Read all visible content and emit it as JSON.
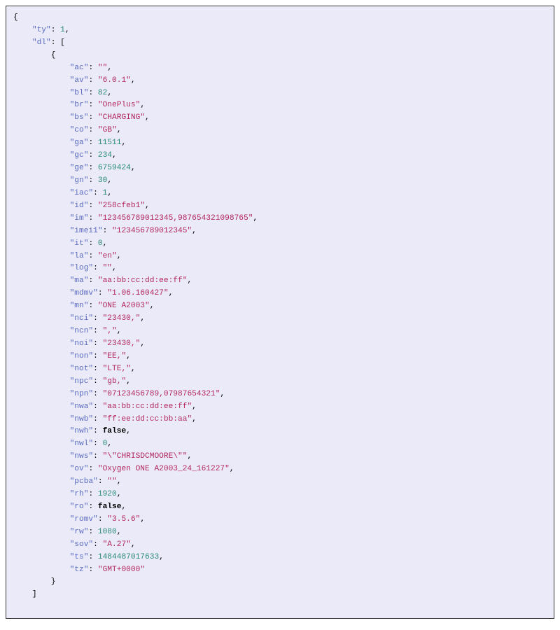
{
  "root": {
    "ty": 1,
    "dl": {
      "ac": "",
      "av": "6.0.1",
      "bl": 82,
      "br": "OnePlus",
      "bs": "CHARGING",
      "co": "GB",
      "ga": 11511,
      "gc": 234,
      "ge": 6759424,
      "gn": 30,
      "iac": 1,
      "id": "258cfeb1",
      "im": "123456789012345,987654321098765",
      "imei1": "123456789012345",
      "it": 0,
      "la": "en",
      "log": "",
      "ma": "aa:bb:cc:dd:ee:ff",
      "mdmv": "1.06.160427",
      "mn": "ONE A2003",
      "nci": "23430,",
      "ncn": ",",
      "noi": "23430,",
      "non": "EE,",
      "not": "LTE,",
      "npc": "gb,",
      "npn": "07123456789,07987654321",
      "nwa": "aa:bb:cc:dd:ee:ff",
      "nwb": "ff:ee:dd:cc:bb:aa",
      "nwh": false,
      "nwl": 0,
      "nws": "\\\"CHRISDCMOORE\\\"",
      "ov": "Oxygen ONE A2003_24_161227",
      "pcba": "",
      "rh": 1920,
      "ro": false,
      "romv": "3.5.6",
      "rw": 1080,
      "sov": "A.27",
      "ts": 1484487017633,
      "tz": "GMT+0000"
    }
  },
  "keys_order": [
    "ac",
    "av",
    "bl",
    "br",
    "bs",
    "co",
    "ga",
    "gc",
    "ge",
    "gn",
    "iac",
    "id",
    "im",
    "imei1",
    "it",
    "la",
    "log",
    "ma",
    "mdmv",
    "mn",
    "nci",
    "ncn",
    "noi",
    "non",
    "not",
    "npc",
    "npn",
    "nwa",
    "nwb",
    "nwh",
    "nwl",
    "nws",
    "ov",
    "pcba",
    "rh",
    "ro",
    "romv",
    "rw",
    "sov",
    "ts",
    "tz"
  ]
}
